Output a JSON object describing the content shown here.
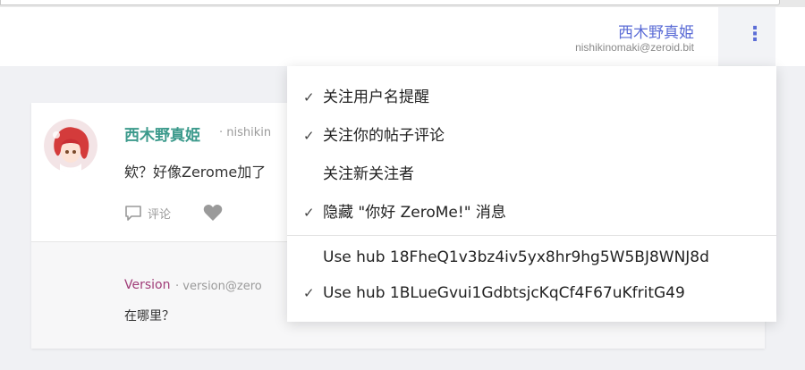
{
  "header": {
    "user_name": "西木野真姫",
    "user_id": "nishikinomaki@zeroid.bit",
    "menu_icon": "vertical-dots-icon"
  },
  "post": {
    "author": "西木野真姫",
    "author_id_partial": "· nishikin",
    "body": "欸？好像Zerome加了",
    "comment_label": "评论",
    "comment_icon": "comment-icon",
    "like_icon": "heart-icon"
  },
  "comment": {
    "author": "Version",
    "author_id_partial": "· version@zero",
    "body": "在哪里？"
  },
  "menu": {
    "items": [
      {
        "label": "关注用户名提醒",
        "checked": "✓"
      },
      {
        "label": "关注你的帖子评论",
        "checked": "✓"
      },
      {
        "label": "关注新关注者",
        "checked": ""
      },
      {
        "label": "隐藏 \"你好 ZeroMe!\" 消息",
        "checked": "✓"
      },
      {
        "label": "Use hub 18FheQ1v3bz4iv5yx8hr9hg5W5BJ8WNJ8d",
        "checked": ""
      },
      {
        "label": "Use hub 1BLueGvui1GdbtsjcKqCf4F67uKfritG49",
        "checked": "✓"
      }
    ]
  },
  "colors": {
    "accent": "#5b6cd6",
    "post_author": "#3c9a8c",
    "comment_author": "#a03c78"
  }
}
